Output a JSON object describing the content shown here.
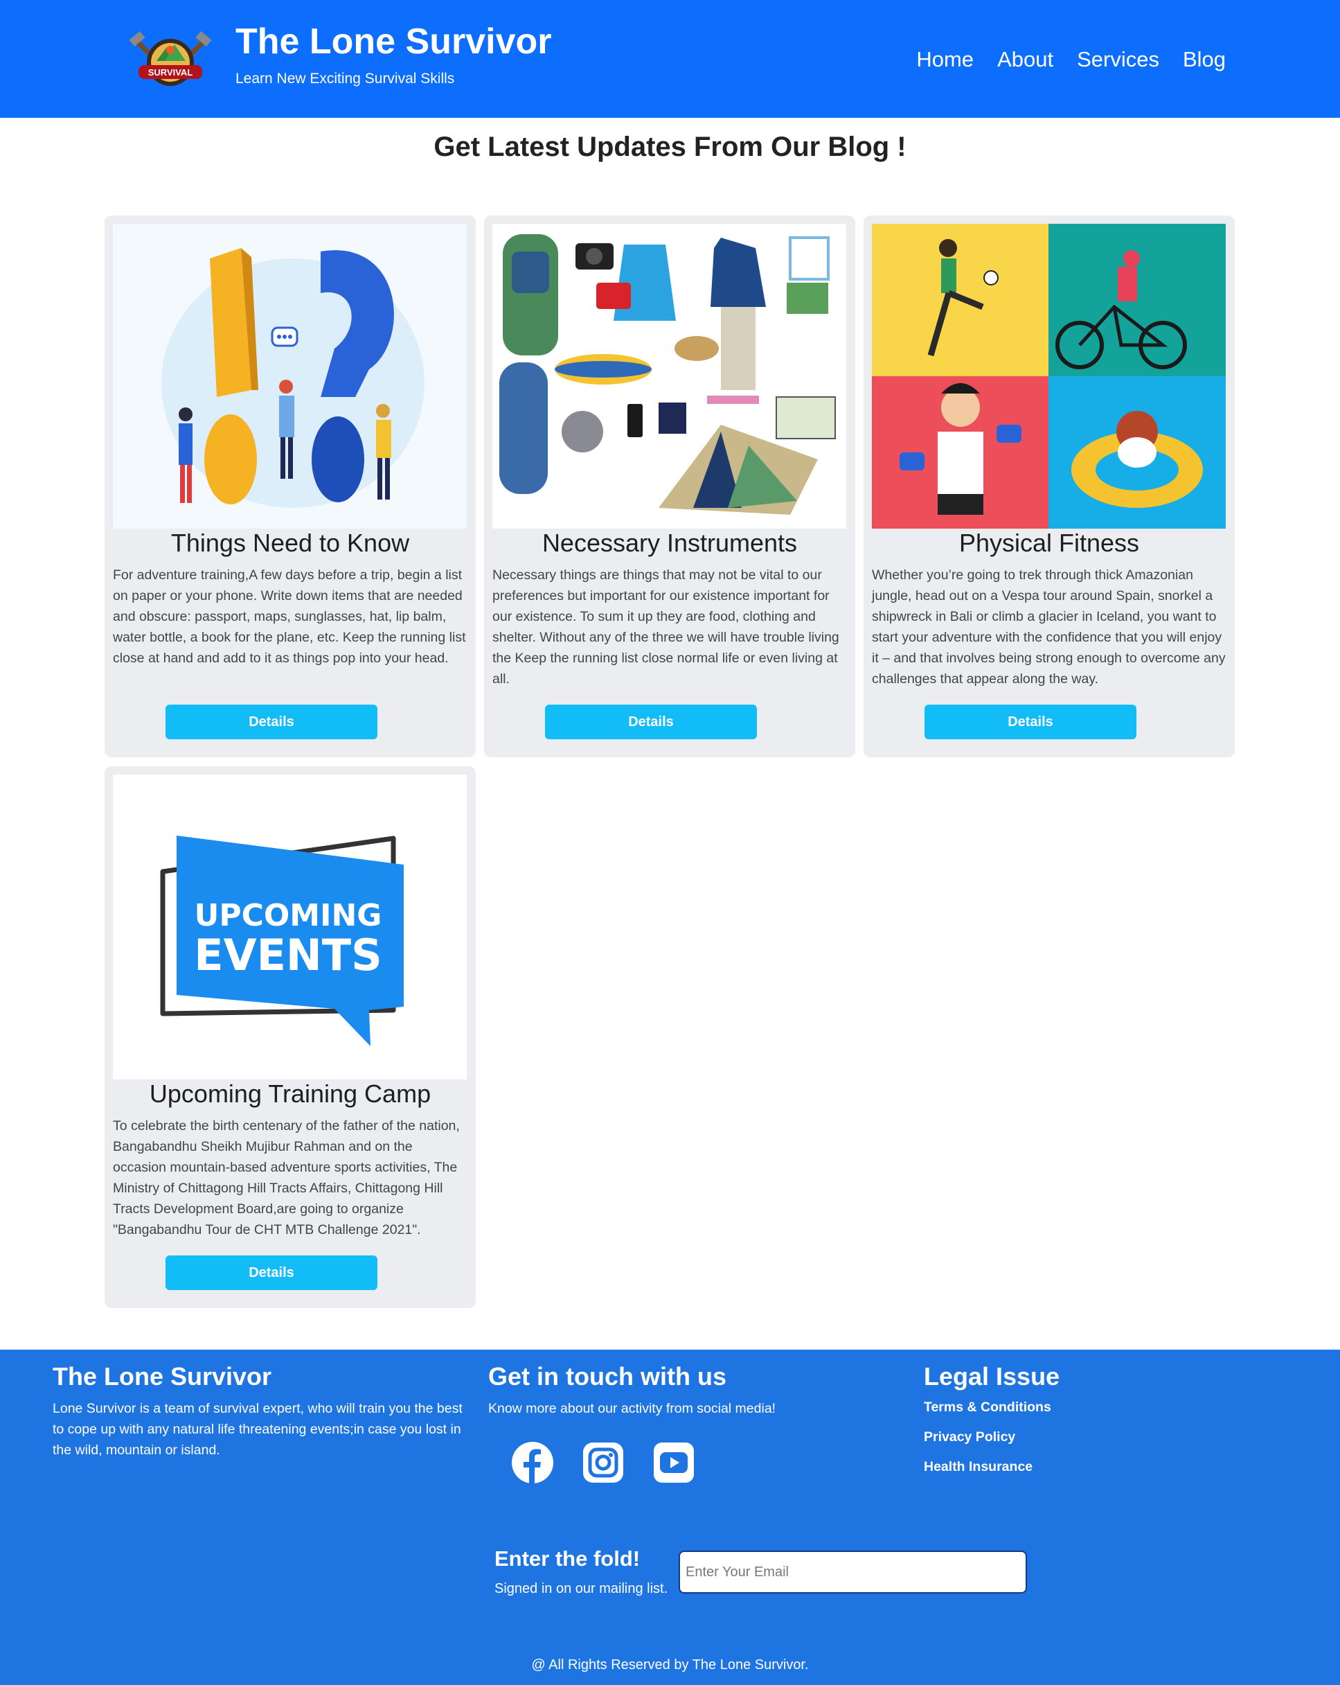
{
  "header": {
    "title": "The Lone Survivor",
    "tagline": "Learn New Exciting Survival Skills",
    "logo_text": "SURVIVAL",
    "nav": [
      "Home",
      "About",
      "Services",
      "Blog"
    ],
    "color": "#0d6efd"
  },
  "blog": {
    "heading": "Get Latest Updates From Our Blog !",
    "cards": [
      {
        "title": "Things Need to Know",
        "body": "For adventure training,A few days before a trip, begin a list on paper or your phone. Write down items that are needed and obscure: passport, maps, sunglasses, hat, lip balm, water bottle, a book for the plane, etc. Keep the running list close at hand and add to it as things pop into your head.",
        "button": "Details"
      },
      {
        "title": "Necessary Instruments",
        "body": "Necessary things are things that may not be vital to our preferences but important for our existence important for our existence. To sum it up they are food, clothing and shelter. Without any of the three we will have trouble living the Keep the running list close normal life or even living at all.",
        "button": "Details"
      },
      {
        "title": "Physical Fitness",
        "body": "Whether you’re going to trek through thick Amazonian jungle, head out on a Vespa tour around Spain, snorkel a shipwreck in Bali or climb a glacier in Iceland, you want to start your adventure with the confidence that you will enjoy it – and that involves being strong enough to overcome any challenges that appear along the way.",
        "button": "Details"
      },
      {
        "title": "Upcoming Training Camp",
        "body": "To celebrate the birth centenary of the father of the nation, Bangabandhu Sheikh Mujibur Rahman and on the occasion mountain-based adventure sports activities, The Ministry of Chittagong Hill Tracts Affairs, Chittagong Hill Tracts Development Board,are going to organize \"Bangabandhu Tour de CHT MTB Challenge 2021\".",
        "button": "Details",
        "image_text_1": "UPCOMING",
        "image_text_2": "EVENTS"
      }
    ],
    "button_color": "#12bdf7"
  },
  "footer": {
    "about_title": "The Lone Survivor",
    "about_text": "Lone Survivor is a team of survival expert, who will train you the best to cope up with any natural life threatening events;in case you lost in the wild, mountain or island.",
    "contact_title": "Get in touch with us",
    "contact_text": "Know more about our activity from social media!",
    "socials": [
      "facebook-icon",
      "instagram-icon",
      "youtube-icon"
    ],
    "legal_title": "Legal Issue",
    "legal_links": [
      "Terms & Conditions",
      "Privacy Policy",
      "Health Insurance"
    ],
    "fold_title": "Enter the fold!",
    "fold_sub": "Signed in on our mailing list.",
    "email_placeholder": "Enter Your Email",
    "copyright": "@ All Rights Reserved by The Lone Survivor.",
    "color": "#1e74e0"
  }
}
